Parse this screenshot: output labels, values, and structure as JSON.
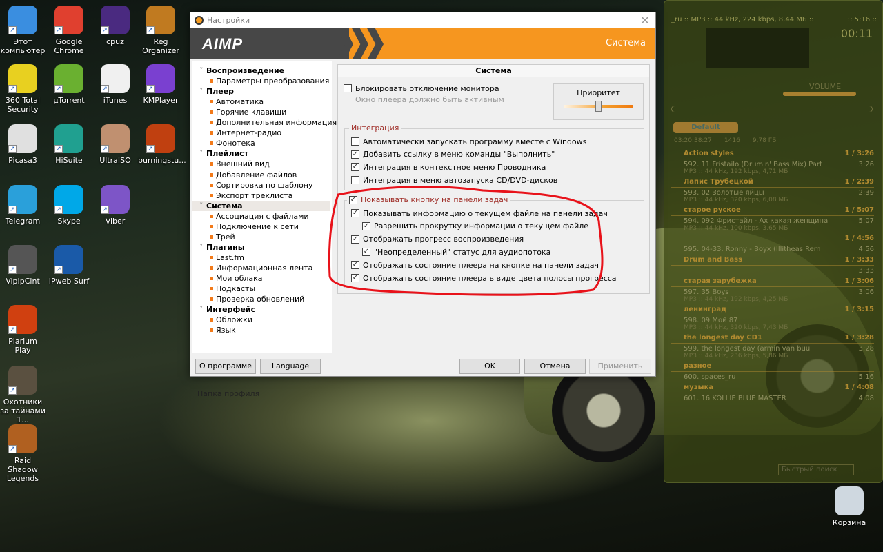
{
  "desktop": {
    "icons": [
      {
        "label": "Этот компьютер",
        "color": "#3a8ee0"
      },
      {
        "label": "Google Chrome",
        "color": "#e0402f"
      },
      {
        "label": "cpuz",
        "color": "#4a2a80"
      },
      {
        "label": "Reg Organizer",
        "color": "#c07a20"
      },
      {
        "label": "360 Total Security",
        "color": "#e8d020"
      },
      {
        "label": "µTorrent",
        "color": "#6ab030"
      },
      {
        "label": "iTunes",
        "color": "#f0f0f0"
      },
      {
        "label": "KMPlayer",
        "color": "#7a40d0"
      },
      {
        "label": "Picasa3",
        "color": "#e0e0e0"
      },
      {
        "label": "HiSuite",
        "color": "#20a090"
      },
      {
        "label": "UltraISO",
        "color": "#c09070"
      },
      {
        "label": "burningstu...",
        "color": "#c04010"
      },
      {
        "label": "Telegram",
        "color": "#2aa0da"
      },
      {
        "label": "Skype",
        "color": "#00a8e8"
      },
      {
        "label": "Viber",
        "color": "#7d55c7"
      },
      {
        "label": "VipIpClnt",
        "color": "#555"
      },
      {
        "label": "IPweb Surf",
        "color": "#1a5aa8"
      },
      {
        "label": "Plarium Play",
        "color": "#d04010"
      },
      {
        "label": "Охотники за тайнами 1...",
        "color": "#5a5040"
      },
      {
        "label": "Raid Shadow Legends",
        "color": "#b06020"
      },
      {
        "label": "Корзина",
        "color": "#cfd8e0"
      }
    ]
  },
  "player": {
    "info": "_ru :: MP3 :: 44 kHz, 224 kbps, 8,44 МБ ::",
    "duration": ":: 5:16 ::",
    "time": "00:11",
    "volume_label": "VOLUME",
    "playlist_tab": "Default",
    "stats": [
      "03:20:38:27",
      "1416",
      "9,78 ГБ"
    ],
    "groups": [
      {
        "name": "Action styles",
        "total": "1 / 3:26",
        "track": "592. 11 Fristailo (Drum'n' Bass Mix) Part",
        "len": "3:26",
        "meta": "MP3 :: 44 kHz, 192 kbps, 4,71 МБ"
      },
      {
        "name": "Лапис Трубецкой",
        "total": "1 / 2:39",
        "track": "593. 02 Золотые яйцы",
        "len": "2:39",
        "meta": "MP3 :: 44 kHz, 320 kbps, 6,08 МБ"
      },
      {
        "name": "старое руское",
        "total": "1 / 5:07",
        "track": "594. 092 Фристайл - Ах какая женщина",
        "len": "5:07",
        "meta": "MP3 :: 44 kHz, 100 kbps, 3,65 МБ"
      },
      {
        "name": "",
        "total": "1 / 4:56",
        "track": "595. 04-33. Ronny - Boyx (Illitheas Rem",
        "len": "4:56",
        "meta": ""
      },
      {
        "name": "Drum and Bass",
        "total": "1 / 3:33",
        "track": "",
        "len": "3:33",
        "meta": ""
      },
      {
        "name": "старая зарубежка",
        "total": "1 / 3:06",
        "track": "597. 35 Boys",
        "len": "3:06",
        "meta": "MP3 :: 44 kHz, 192 kbps, 4,25 МБ"
      },
      {
        "name": "ленинград",
        "total": "1 / 3:15",
        "track": "598. 09 Мой 87",
        "len": "",
        "meta": "MP3 :: 44 kHz, 320 kbps, 7,43 МБ"
      },
      {
        "name": "the longest day CD1",
        "total": "1 / 3:28",
        "track": "599. the longest day (armin van buu",
        "len": "3:28",
        "meta": "MP3 :: 44 kHz, 236 kbps, 5,86 МБ"
      },
      {
        "name": "разное",
        "total": "",
        "track": "600. spaces_ru",
        "len": "5:16",
        "meta": ""
      },
      {
        "name": "музыка",
        "total": "1 / 4:08",
        "track": "601. 16 KOLLIE BLUE MASTER",
        "len": "4:08",
        "meta": ""
      }
    ],
    "search_placeholder": "Быстрый поиск"
  },
  "dialog": {
    "title": "Настройки",
    "brand": "AIMP",
    "section": "Система",
    "tree": [
      {
        "type": "h",
        "label": "Воспроизведение"
      },
      {
        "type": "s",
        "label": "Параметры преобразования"
      },
      {
        "type": "h",
        "label": "Плеер"
      },
      {
        "type": "s",
        "label": "Автоматика"
      },
      {
        "type": "s",
        "label": "Горячие клавиши"
      },
      {
        "type": "s",
        "label": "Дополнительная информация"
      },
      {
        "type": "s",
        "label": "Интернет-радио"
      },
      {
        "type": "s",
        "label": "Фонотека"
      },
      {
        "type": "h",
        "label": "Плейлист"
      },
      {
        "type": "s",
        "label": "Внешний вид"
      },
      {
        "type": "s",
        "label": "Добавление файлов"
      },
      {
        "type": "s",
        "label": "Сортировка по шаблону"
      },
      {
        "type": "s",
        "label": "Экспорт треклиста"
      },
      {
        "type": "h",
        "label": "Система",
        "selected": true
      },
      {
        "type": "s",
        "label": "Ассоциация с файлами"
      },
      {
        "type": "s",
        "label": "Подключение к сети"
      },
      {
        "type": "s",
        "label": "Трей"
      },
      {
        "type": "h",
        "label": "Плагины"
      },
      {
        "type": "s",
        "label": "Last.fm"
      },
      {
        "type": "s",
        "label": "Информационная лента"
      },
      {
        "type": "s",
        "label": "Мои облака"
      },
      {
        "type": "s",
        "label": "Подкасты"
      },
      {
        "type": "s",
        "label": "Проверка обновлений"
      },
      {
        "type": "h",
        "label": "Интерфейс"
      },
      {
        "type": "s",
        "label": "Обложки"
      },
      {
        "type": "s",
        "label": "Язык"
      }
    ],
    "profile_link": "Папка профиля",
    "panel_title": "Система",
    "block_monitor": {
      "label": "Блокировать отключение монитора",
      "checked": false,
      "hint": "Окно плеера должно быть активным"
    },
    "priority": {
      "label": "Приоритет",
      "value_fraction": 0.5
    },
    "integration": {
      "title": "Интеграция",
      "items": [
        {
          "label": "Автоматически запускать программу вместе с Windows",
          "checked": false
        },
        {
          "label": "Добавить ссылку в меню команды \"Выполнить\"",
          "checked": true
        },
        {
          "label": "Интеграция в контекстное меню Проводника",
          "checked": true
        },
        {
          "label": "Интеграция в меню автозапуска CD/DVD-дисков",
          "checked": false
        }
      ]
    },
    "taskbar": {
      "title": "Показывать кнопку на панели задач",
      "checked": true,
      "items": [
        {
          "label": "Показывать информацию о текущем файле на панели задач",
          "checked": true,
          "indent": false
        },
        {
          "label": "Разрешить прокрутку информации о текущем файле",
          "checked": true,
          "indent": true
        },
        {
          "label": "Отображать прогресс воспроизведения",
          "checked": true,
          "indent": false
        },
        {
          "label": "\"Неопределенный\" статус для аудиопотока",
          "checked": true,
          "indent": true
        },
        {
          "label": "Отображать состояние плеера на кнопке на панели задач",
          "checked": true,
          "indent": false
        },
        {
          "label": "Отображать состояние плеера в виде цвета полосы прогресса",
          "checked": true,
          "indent": false
        }
      ]
    },
    "buttons": {
      "about": "О программе",
      "language": "Language",
      "ok": "OK",
      "cancel": "Отмена",
      "apply": "Применить"
    },
    "accent": "#f6961f"
  }
}
